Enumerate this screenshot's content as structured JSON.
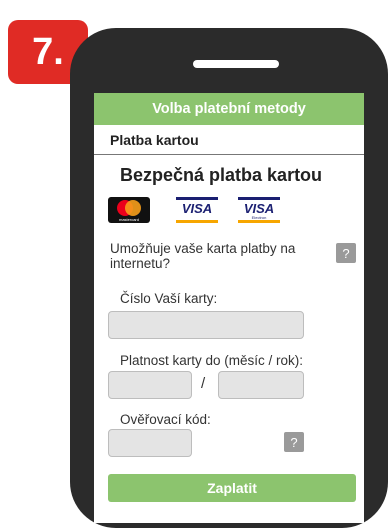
{
  "step_number": "7.",
  "header": {
    "title": "Volba platební metody"
  },
  "subheader": {
    "title": "Platba kartou"
  },
  "main_title": "Bezpečná platba kartou",
  "logos": {
    "mastercard": "mastercard",
    "visa": "VISA",
    "visa_electron_brand": "VISA",
    "visa_electron_sub": "Electron"
  },
  "question": "Umožňuje vaše karta platby na internetu?",
  "help_symbol": "?",
  "card_number": {
    "label": "Číslo Vaší karty:",
    "value": ""
  },
  "expiry": {
    "label": "Platnost karty do (měsíc / rok):",
    "separator": "/",
    "month": "",
    "year": ""
  },
  "cvc": {
    "label": "Ověřovací kód:",
    "value": ""
  },
  "pay_button": "Zaplatit",
  "colors": {
    "accent_green": "#8cc46e",
    "badge_red": "#e02b25",
    "phone_body": "#2b2b2b",
    "field_gray": "#e4e4e4",
    "help_gray": "#9a9a9a"
  }
}
